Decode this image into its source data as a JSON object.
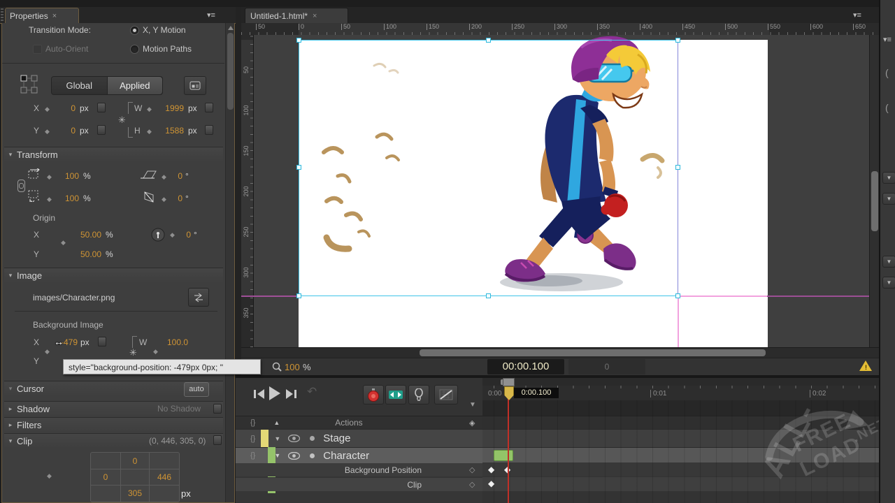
{
  "icons": {
    "close": "×",
    "menu_small": "≡",
    "paren": "(",
    "undo": "↶",
    "chev_down": "▾",
    "chev_right": "▸",
    "diamond": "◇",
    "diamond_filled": "◆",
    "diamond_key": "◈",
    "link": "✳",
    "warn": "!"
  },
  "properties": {
    "tab": "Properties",
    "transition": {
      "label": "Transition Mode:",
      "xy": "X, Y Motion",
      "auto_orient": "Auto-Orient",
      "paths": "Motion Paths"
    },
    "buttons": {
      "global": "Global",
      "applied": "Applied"
    },
    "position": {
      "x": "X",
      "x_val": "0",
      "y": "Y",
      "y_val": "0",
      "w": "W",
      "w_val": "1999",
      "h": "H",
      "h_val": "1588",
      "unit": "px"
    },
    "transform": {
      "title": "Transform",
      "scale_x": "100",
      "scale_y": "100",
      "pct": "%",
      "skew_x": "0",
      "skew_y": "0",
      "deg": "°",
      "origin": "Origin",
      "ox_label": "X",
      "ox": "50.00",
      "oy_label": "Y",
      "oy": "50.00",
      "rot": "0"
    },
    "image": {
      "title": "Image",
      "src": "images/Character.png",
      "bg": "Background Image",
      "x_label": "X",
      "x_val": "-479",
      "unit": "px",
      "w_label": "W",
      "w_val": "100.0",
      "y_label": "Y"
    },
    "tooltip": "style=\"background-position: -479px 0px; \"",
    "cursor": {
      "title": "Cursor",
      "auto": "auto"
    },
    "shadow": {
      "title": "Shadow",
      "value": "No Shadow"
    },
    "filters": {
      "title": "Filters"
    },
    "clip": {
      "title": "Clip",
      "summary": "(0, 446, 305, 0)",
      "top": "0",
      "left": "0",
      "right": "446",
      "bottom": "305",
      "unit": "px"
    }
  },
  "stage": {
    "tab": "Untitled-1.html*",
    "h_ruler": [
      "50",
      "0",
      "50",
      "100",
      "150",
      "200",
      "250",
      "300",
      "350",
      "400",
      "450",
      "500",
      "550",
      "600",
      "650"
    ],
    "v_ruler": [
      "50",
      "100",
      "150",
      "200",
      "250",
      "300",
      "350"
    ],
    "zoom": "100",
    "zoom_unit": "%",
    "timecode": "00:00.100",
    "frame_count": "0"
  },
  "timeline": {
    "ruler": [
      "0:00",
      "0:01",
      "0:02"
    ],
    "playhead": "0:00.100",
    "actions_label": "Actions",
    "rows": [
      {
        "label": "Stage"
      },
      {
        "label": "Character"
      },
      {
        "label": "Background Position"
      },
      {
        "label": "Clip"
      }
    ]
  },
  "watermark": {
    "all": "ALL-",
    "free": "FREE",
    "load": "LOAD",
    "net": ".NET"
  }
}
